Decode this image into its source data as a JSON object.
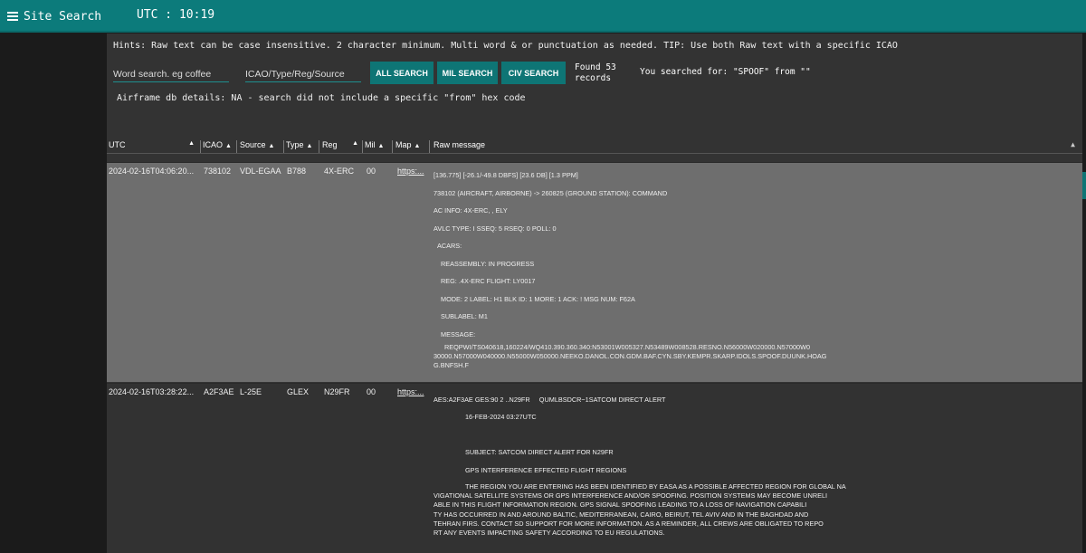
{
  "topbar": {
    "menu_label": "Site Search",
    "utc_label": "UTC",
    "utc_time": "10:19"
  },
  "hints": "Hints: Raw text can be case insensitive. 2 character minimum. Multi word & or punctuation as needed. TIP: Use both Raw text with a specific ICAO",
  "search": {
    "word_placeholder": "Word search. eg coffee",
    "icao_placeholder": "ICAO/Type/Reg/Source",
    "all_label": "ALL SEARCH",
    "mil_label": "MIL SEARCH",
    "civ_label": "CIV SEARCH",
    "found_line1": "Found 53",
    "found_line2": "records",
    "you_searched": "You searched for: \"SPOOF\" from \"\""
  },
  "airframe": "Airframe db details: NA - search did not include a specific \"from\" hex code",
  "table": {
    "headers": {
      "utc": "UTC",
      "icao": "ICAO",
      "source": "Source",
      "type": "Type",
      "reg": "Reg",
      "mil": "Mil",
      "map": "Map",
      "raw": "Raw message"
    },
    "rows": [
      {
        "utc": "2024-02-16T04:06:20...",
        "icao": "738102",
        "source": "VDL-EGAA",
        "type": "B788",
        "reg": "4X-ERC",
        "mil": "00",
        "map": "https:...",
        "raw": [
          "[136.775] [-26.1/-49.8 DBFS] [23.6 DB] [1.3 PPM]",
          "738102 (AIRCRAFT, AIRBORNE) -> 260825 (GROUND STATION): COMMAND",
          "AC INFO: 4X-ERC, , ELY",
          "AVLC TYPE: I SSEQ: 5 RSEQ: 0 POLL: 0",
          "ACARS:",
          "REASSEMBLY: IN PROGRESS",
          "REG: .4X-ERC FLIGHT: LY0017",
          "MODE: 2 LABEL: H1 BLK ID: 1 MORE: 1 ACK: ! MSG NUM: F62A",
          "SUBLABEL: M1",
          "MESSAGE:"
        ],
        "raw_message_body": [
          "REQPWI/TS040618,160224/WQ410.390.360.340:N53001W005327.N53489W008528.RESNO.N56000W020000.N57000W0",
          "30000.N57000W040000.N55000W050000.NEEKO.DANOL.CON.GDM.BAF.CYN.SBY.KEMPR.SKARP.IDOLS.SPOOF.DUUNK.HOAG",
          "G.BNFSH.F"
        ]
      },
      {
        "utc": "2024-02-16T03:28:22...",
        "icao": "A2F3AE",
        "source": "L-25E",
        "type": "GLEX",
        "reg": "N29FR",
        "mil": "00",
        "map": "https:...",
        "raw": [
          "AES:A2F3AE GES:90 2 ..N29FR     QUMLBSDCR~1SATCOM DIRECT ALERT",
          "16-FEB-2024 03:27UTC",
          "",
          "SUBJECT: SATCOM DIRECT ALERT FOR N29FR",
          "GPS INTERFERENCE EFFECTED FLIGHT REGIONS"
        ],
        "raw_message_body": [
          "THE REGION YOU ARE ENTERING HAS BEEN IDENTIFIED BY EASA AS A POSSIBLE AFFECTED REGION FOR GLOBAL NA",
          "VIGATIONAL SATELLITE SYSTEMS OR GPS INTERFERENCE AND/OR SPOOFING. POSITION SYSTEMS MAY BECOME UNRELI",
          "ABLE IN THIS FLIGHT INFORMATION REGION. GPS SIGNAL SPOOFING LEADING TO A LOSS OF NAVIGATION CAPABILI",
          "TY HAS OCCURRED IN AND AROUND BALTIC, MEDITERRANEAN, CAIRO, BEIRUT, TEL AVIV AND IN THE BAGHDAD AND",
          "TEHRAN FIRS. CONTACT SD SUPPORT FOR MORE INFORMATION. AS A REMINDER, ALL CREWS ARE OBLIGATED TO REPO",
          "RT ANY EVENTS IMPACTING SAFETY ACCORDING TO EU REGULATIONS."
        ]
      }
    ]
  },
  "colors": {
    "topbar": "#0c7b7b",
    "button": "#0e7575",
    "highlight_row": "#6e6e6e",
    "panel": "#333333"
  }
}
